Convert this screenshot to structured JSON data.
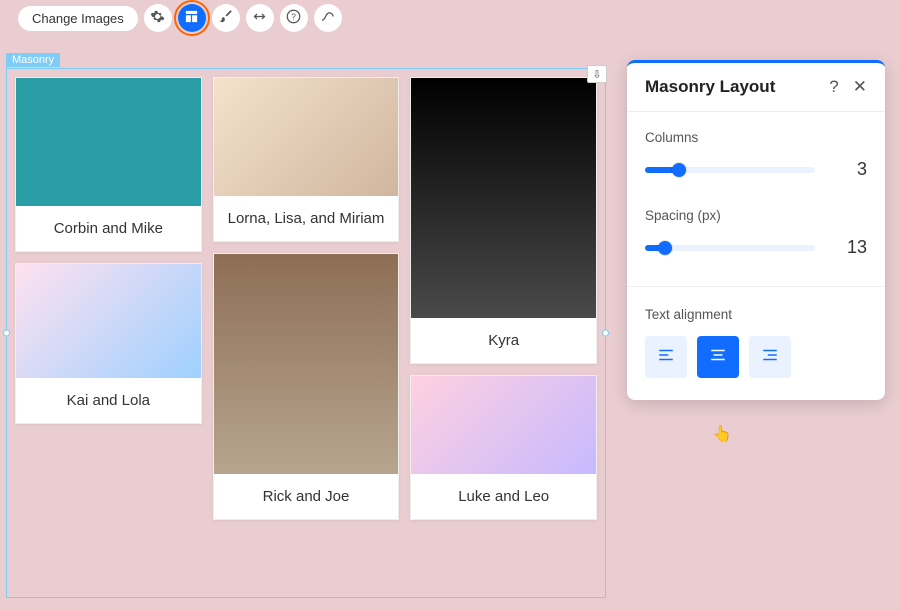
{
  "toolbar": {
    "change_images_label": "Change Images",
    "icons": {
      "settings": "gear-icon",
      "layout": "layout-icon",
      "design": "brush-icon",
      "stretch": "arrows-h-icon",
      "help": "question-icon",
      "animation": "curve-icon"
    }
  },
  "widget": {
    "label": "Masonry",
    "download_title": "Download"
  },
  "cards": [
    {
      "caption": "Corbin and Mike"
    },
    {
      "caption": "Lorna, Lisa, and Miriam"
    },
    {
      "caption": "Kyra"
    },
    {
      "caption": "Kai and Lola"
    },
    {
      "caption": "Rick and Joe"
    },
    {
      "caption": "Luke and Leo"
    }
  ],
  "panel": {
    "title": "Masonry Layout",
    "columns_label": "Columns",
    "columns_value": "3",
    "spacing_label": "Spacing (px)",
    "spacing_value": "13",
    "alignment_label": "Text alignment",
    "alignment_options": [
      "left",
      "center",
      "right"
    ],
    "alignment_selected": "center"
  }
}
